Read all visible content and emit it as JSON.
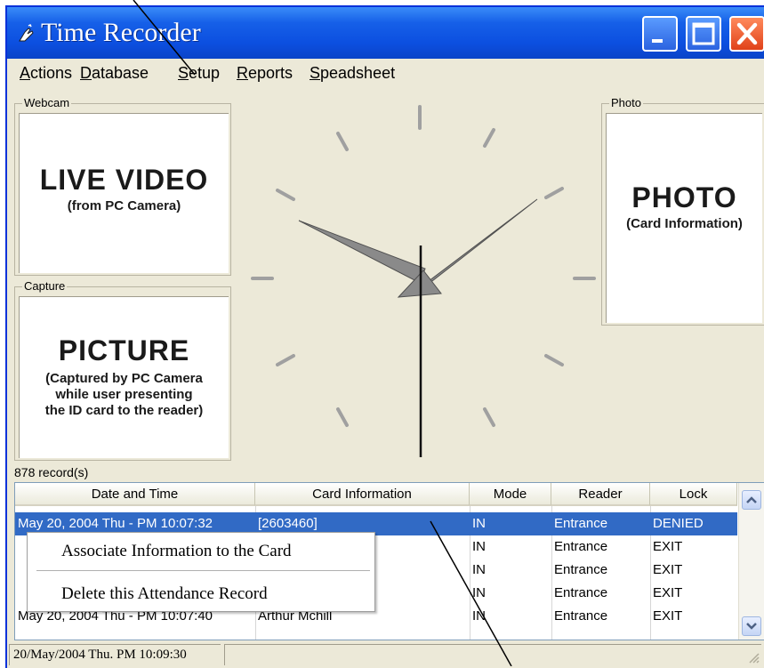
{
  "window": {
    "title": "Time Recorder",
    "app_icon": "hand-pointer-icon"
  },
  "menu": [
    "Actions",
    "Database",
    "Setup",
    "Reports",
    "Speadsheet"
  ],
  "webcam": {
    "group_title": "Webcam",
    "label": "LIVE VIDEO",
    "sub": "(from PC Camera)"
  },
  "capture": {
    "group_title": "Capture",
    "label": "PICTURE",
    "sub_lines": [
      "(Captured by PC Camera",
      "while user presenting",
      "the ID card to the reader)"
    ]
  },
  "photo": {
    "group_title": "Photo",
    "label": "PHOTO",
    "sub": "(Card Information)"
  },
  "records": {
    "count_label": "878 record(s)",
    "columns": [
      "Date and Time",
      "Card Information",
      "Mode",
      "Reader",
      "Lock"
    ],
    "rows": [
      {
        "datetime": "May 20, 2004 Thu - PM 10:07:32",
        "card": "[2603460]",
        "mode": "IN",
        "reader": "Entrance",
        "lock": "DENIED"
      },
      {
        "datetime": "",
        "card": "",
        "mode": "IN",
        "reader": "Entrance",
        "lock": "EXIT"
      },
      {
        "datetime": "",
        "card": "",
        "mode": "IN",
        "reader": "Entrance",
        "lock": "EXIT"
      },
      {
        "datetime": "",
        "card": "",
        "mode": "IN",
        "reader": "Entrance",
        "lock": "EXIT"
      },
      {
        "datetime": "May 20, 2004 Thu - PM 10:07:40",
        "card": "Arthur Mchill",
        "mode": "IN",
        "reader": "Entrance",
        "lock": "EXIT"
      }
    ]
  },
  "context_menu": {
    "items": [
      "Associate Information to the Card",
      "Delete this Attendance Record"
    ]
  },
  "status": {
    "text": "20/May/2004 Thu. PM 10:09:30"
  },
  "colors": {
    "selection": "#316ac5",
    "titlebar": "#0c4fe0",
    "close_button": "#e0421a"
  }
}
